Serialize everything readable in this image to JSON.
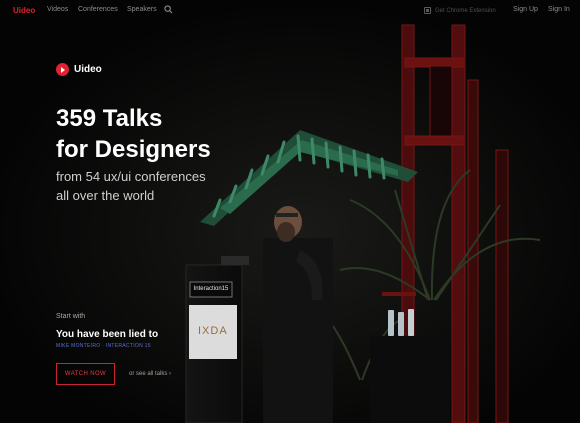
{
  "nav": {
    "brand": "Uideo",
    "links": [
      "Videos",
      "Conferences",
      "Speakers"
    ],
    "extension": "Get Chrome Extension",
    "signup": "Sign Up",
    "signin": "Sign In"
  },
  "hero": {
    "logo_text": "Uideo",
    "title_line1": "359 Talks",
    "title_line2": "for Designers",
    "subtitle_line1": "from 54 ux/ui conferences",
    "subtitle_line2": "all over the world"
  },
  "featured": {
    "start_label": "Start with",
    "title": "You have been lied to",
    "meta": "MIKE MONTEIRO · INTERACTION 15",
    "watch_label": "WATCH NOW",
    "see_all": "or see all talks ›"
  },
  "podium": {
    "sign": "Interaction15",
    "badge": "IXDA"
  },
  "colors": {
    "accent": "#e0212f",
    "meta": "#5c6ed6",
    "background": "#050505"
  }
}
